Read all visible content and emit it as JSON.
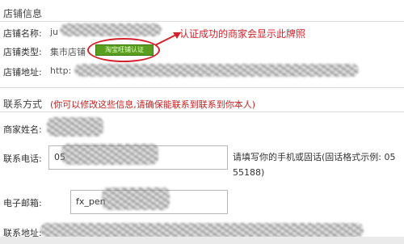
{
  "shop_info": {
    "section_title": "店铺信息",
    "name_label": "店铺名称:",
    "name_value_visible": "ju",
    "type_label": "店铺类型:",
    "type_value": "集市店铺",
    "badge_text": "淘宝旺铺认证",
    "address_label": "店铺地址:",
    "address_prefix": "http:"
  },
  "annotation": {
    "text": "认证成功的商家会显示此牌照",
    "color": "#d2222c"
  },
  "contact": {
    "section_title": "联系方式",
    "note": "(你可以修改这些信息,请确保能联系到联系到你本人)",
    "merchant_label": "商家姓名:",
    "phone_label": "联系电话:",
    "phone_value_visible": "05",
    "phone_hint": "请填写你的手机或固话(固话格式示例: 05 55188)",
    "email_label": "电子邮箱:",
    "email_value_visible": "fx_pen",
    "address_label": "联系地址:"
  }
}
